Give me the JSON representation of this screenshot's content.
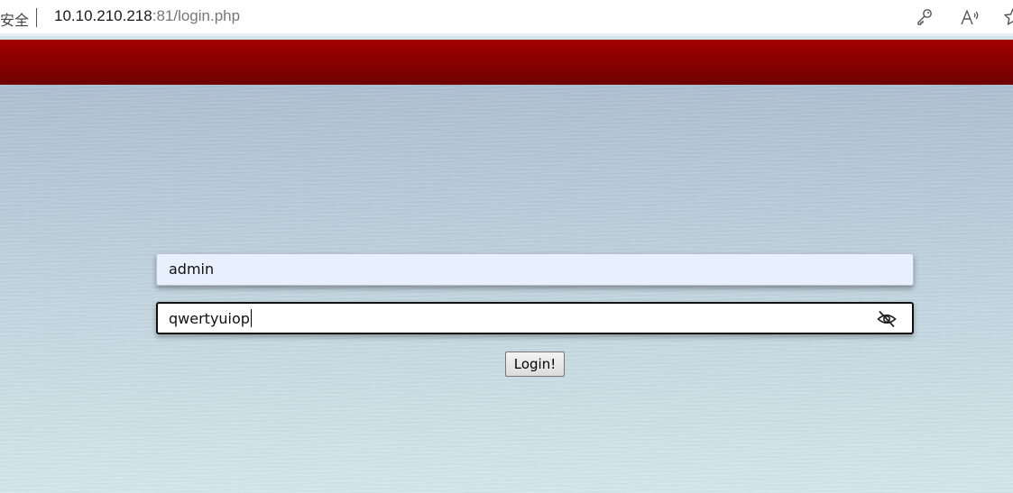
{
  "browser": {
    "security_label": "安全",
    "url_host": "10.10.210.218",
    "url_rest": ":81/login.php",
    "icons": [
      "key-icon",
      "read-aloud-icon",
      "favorite-star-icon"
    ]
  },
  "header": {
    "color": "#8a0000"
  },
  "login_form": {
    "username_value": "admin",
    "password_value": "qwertyuiop",
    "reveal_icon": "eye-slash-icon",
    "submit_label": "Login!"
  }
}
